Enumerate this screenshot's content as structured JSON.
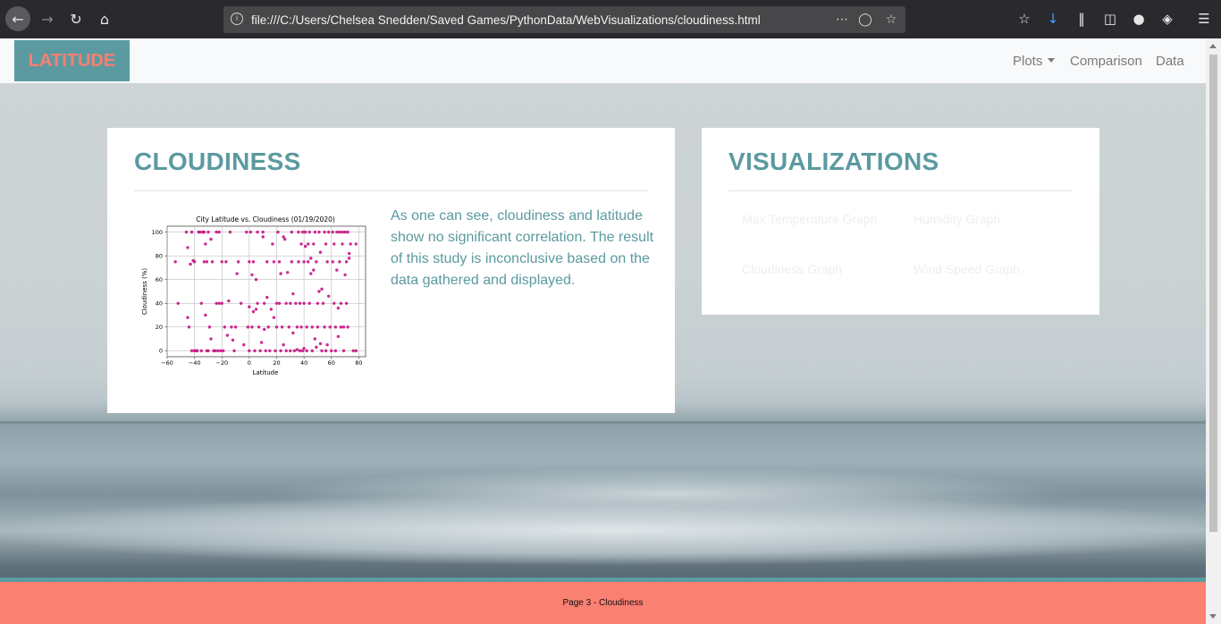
{
  "browser": {
    "url": "file:///C:/Users/Chelsea Snedden/Saved Games/PythonData/WebVisualizations/cloudiness.html"
  },
  "navbar": {
    "brand": "LATITUDE",
    "links": [
      "Plots",
      "Comparison",
      "Data"
    ]
  },
  "main_card": {
    "title": "CLOUDINESS",
    "description": "As one can see, cloudiness and latitude show no significant correlation. The result of this study is inconclusive based on the data gathered and displayed."
  },
  "viz_card": {
    "title": "VISUALIZATIONS",
    "links": [
      "Max Temperature Graph",
      "Humidity Graph",
      "Cloudiness Graph",
      "Wind Speed Graph"
    ]
  },
  "footer": {
    "text": "Page 3 - Cloudiness"
  },
  "colors": {
    "accent": "#5b9aa0",
    "salmon": "#fa8072",
    "points": "#c71585"
  },
  "chart_data": {
    "type": "scatter",
    "title": "City Latitude vs. Cloudiness (01/19/2020)",
    "xlabel": "Latitude",
    "ylabel": "Cloudiness (%)",
    "xlim": [
      -60,
      85
    ],
    "ylim": [
      -5,
      105
    ],
    "xticks": [
      -60,
      -40,
      -20,
      0,
      20,
      40,
      60,
      80
    ],
    "yticks": [
      0,
      20,
      40,
      60,
      80,
      100
    ],
    "grid": true,
    "series": [
      {
        "points": [
          [
            -54,
            75
          ],
          [
            -52,
            40
          ],
          [
            -46,
            100
          ],
          [
            -45,
            87
          ],
          [
            -45,
            28
          ],
          [
            -44,
            20
          ],
          [
            -43,
            73
          ],
          [
            -42,
            100
          ],
          [
            -41,
            76
          ],
          [
            -40,
            75
          ],
          [
            -42,
            0
          ],
          [
            -40,
            0
          ],
          [
            -39,
            0
          ],
          [
            -38,
            0
          ],
          [
            -37,
            100
          ],
          [
            -36,
            100
          ],
          [
            -35,
            40
          ],
          [
            -35,
            0
          ],
          [
            -34,
            100
          ],
          [
            -33,
            100
          ],
          [
            -33,
            75
          ],
          [
            -32,
            90
          ],
          [
            -32,
            30
          ],
          [
            -31,
            75
          ],
          [
            -31,
            0
          ],
          [
            -30,
            100
          ],
          [
            -30,
            0
          ],
          [
            -29,
            20
          ],
          [
            -28,
            94
          ],
          [
            -28,
            10
          ],
          [
            -27,
            75
          ],
          [
            -26,
            0
          ],
          [
            -25,
            0
          ],
          [
            -24,
            100
          ],
          [
            -24,
            40
          ],
          [
            -23,
            0
          ],
          [
            -22,
            100
          ],
          [
            -22,
            40
          ],
          [
            -21,
            0
          ],
          [
            -20,
            75
          ],
          [
            -20,
            40
          ],
          [
            -19,
            0
          ],
          [
            -18,
            20
          ],
          [
            -17,
            75
          ],
          [
            -16,
            13
          ],
          [
            -15,
            42
          ],
          [
            -14,
            100
          ],
          [
            -13,
            20
          ],
          [
            -12,
            9
          ],
          [
            -11,
            0
          ],
          [
            -10,
            20
          ],
          [
            -9,
            65
          ],
          [
            -8,
            75
          ],
          [
            -6,
            40
          ],
          [
            -4,
            5
          ],
          [
            -2,
            100
          ],
          [
            -1,
            20
          ],
          [
            0,
            75
          ],
          [
            0,
            37
          ],
          [
            0,
            0
          ],
          [
            1,
            100
          ],
          [
            2,
            64
          ],
          [
            2,
            20
          ],
          [
            3,
            75
          ],
          [
            3,
            33
          ],
          [
            4,
            0
          ],
          [
            5,
            60
          ],
          [
            5,
            35
          ],
          [
            6,
            100
          ],
          [
            6,
            40
          ],
          [
            7,
            20
          ],
          [
            8,
            0
          ],
          [
            9,
            7
          ],
          [
            10,
            96
          ],
          [
            10,
            100
          ],
          [
            11,
            40
          ],
          [
            11,
            18
          ],
          [
            12,
            0
          ],
          [
            13,
            75
          ],
          [
            13,
            45
          ],
          [
            14,
            20
          ],
          [
            15,
            0
          ],
          [
            16,
            35
          ],
          [
            17,
            90
          ],
          [
            18,
            75
          ],
          [
            18,
            28
          ],
          [
            19,
            0
          ],
          [
            20,
            40
          ],
          [
            20,
            20
          ],
          [
            21,
            100
          ],
          [
            22,
            75
          ],
          [
            22,
            40
          ],
          [
            23,
            65
          ],
          [
            23,
            0
          ],
          [
            24,
            20
          ],
          [
            25,
            96
          ],
          [
            25,
            5
          ],
          [
            26,
            94
          ],
          [
            27,
            40
          ],
          [
            27,
            0
          ],
          [
            28,
            66
          ],
          [
            29,
            20
          ],
          [
            30,
            0
          ],
          [
            30,
            40
          ],
          [
            31,
            100
          ],
          [
            31,
            75
          ],
          [
            32,
            48
          ],
          [
            32,
            15
          ],
          [
            33,
            0
          ],
          [
            34,
            40
          ],
          [
            35,
            20
          ],
          [
            35,
            1
          ],
          [
            36,
            100
          ],
          [
            36,
            75
          ],
          [
            37,
            0
          ],
          [
            37,
            40
          ],
          [
            38,
            90
          ],
          [
            38,
            20
          ],
          [
            39,
            0
          ],
          [
            39,
            100
          ],
          [
            40,
            75
          ],
          [
            40,
            40
          ],
          [
            40,
            2
          ],
          [
            41,
            100
          ],
          [
            41,
            88
          ],
          [
            42,
            20
          ],
          [
            42,
            0
          ],
          [
            43,
            75
          ],
          [
            43,
            90
          ],
          [
            44,
            40
          ],
          [
            44,
            100
          ],
          [
            45,
            78
          ],
          [
            45,
            65
          ],
          [
            46,
            20
          ],
          [
            46,
            0
          ],
          [
            47,
            90
          ],
          [
            47,
            68
          ],
          [
            48,
            100
          ],
          [
            48,
            10
          ],
          [
            49,
            75
          ],
          [
            49,
            3
          ],
          [
            50,
            40
          ],
          [
            50,
            20
          ],
          [
            51,
            100
          ],
          [
            51,
            50
          ],
          [
            52,
            83
          ],
          [
            52,
            6
          ],
          [
            53,
            52
          ],
          [
            53,
            0
          ],
          [
            54,
            40
          ],
          [
            55,
            100
          ],
          [
            55,
            20
          ],
          [
            56,
            90
          ],
          [
            56,
            0
          ],
          [
            57,
            75
          ],
          [
            57,
            5
          ],
          [
            58,
            46
          ],
          [
            58,
            100
          ],
          [
            59,
            20
          ],
          [
            60,
            0
          ],
          [
            61,
            100
          ],
          [
            61,
            75
          ],
          [
            62,
            40
          ],
          [
            62,
            90
          ],
          [
            63,
            20
          ],
          [
            63,
            0
          ],
          [
            64,
            100
          ],
          [
            64,
            68
          ],
          [
            65,
            36
          ],
          [
            65,
            12
          ],
          [
            66,
            100
          ],
          [
            66,
            75
          ],
          [
            67,
            40
          ],
          [
            67,
            20
          ],
          [
            68,
            100
          ],
          [
            68,
            90
          ],
          [
            69,
            20
          ],
          [
            69,
            0
          ],
          [
            70,
            100
          ],
          [
            70,
            64
          ],
          [
            71,
            40
          ],
          [
            71,
            75
          ],
          [
            72,
            100
          ],
          [
            72,
            20
          ],
          [
            73,
            78
          ],
          [
            73,
            82
          ],
          [
            74,
            90
          ],
          [
            76,
            0
          ],
          [
            78,
            90
          ],
          [
            78,
            0
          ]
        ]
      }
    ]
  }
}
